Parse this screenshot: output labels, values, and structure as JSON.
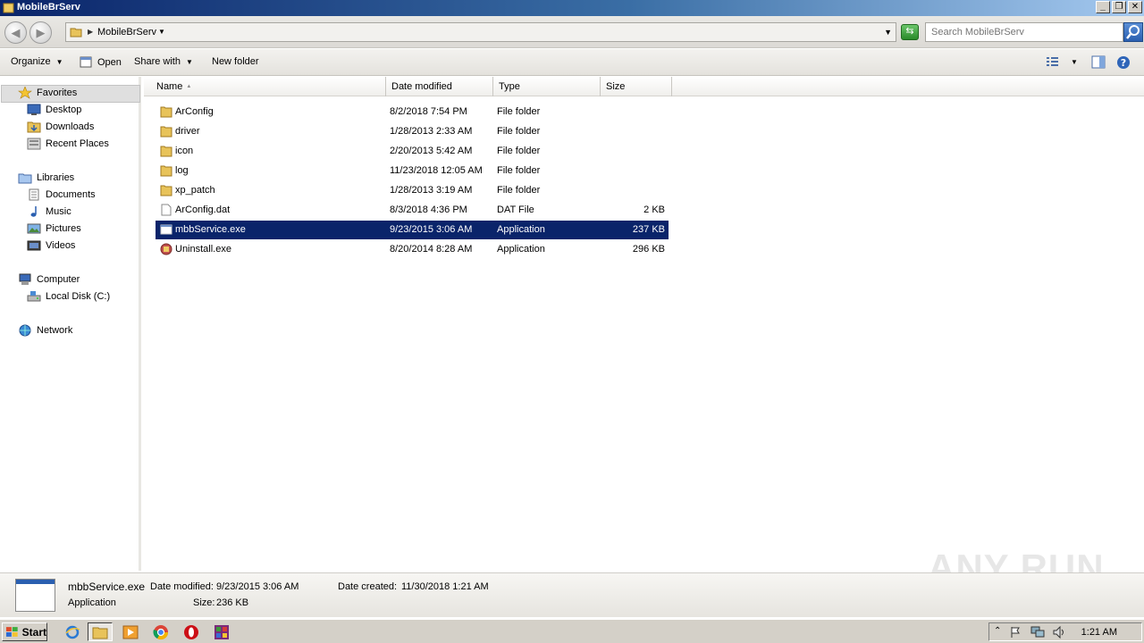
{
  "window": {
    "title": "MobileBrServ"
  },
  "address": {
    "crumb": "MobileBrServ"
  },
  "search": {
    "placeholder": "Search MobileBrServ"
  },
  "toolbar": {
    "organize": "Organize",
    "open": "Open",
    "share_with": "Share with",
    "new_folder": "New folder"
  },
  "nav": {
    "favorites": "Favorites",
    "desktop": "Desktop",
    "downloads": "Downloads",
    "recent_places": "Recent Places",
    "libraries": "Libraries",
    "documents": "Documents",
    "music": "Music",
    "pictures": "Pictures",
    "videos": "Videos",
    "computer": "Computer",
    "local_disk": "Local Disk (C:)",
    "network": "Network"
  },
  "columns": {
    "name": "Name",
    "date_modified": "Date modified",
    "type": "Type",
    "size": "Size"
  },
  "files": [
    {
      "name": "ArConfig",
      "date": "8/2/2018 7:54 PM",
      "type": "File folder",
      "size": "",
      "icon": "folder-icon"
    },
    {
      "name": "driver",
      "date": "1/28/2013 2:33 AM",
      "type": "File folder",
      "size": "",
      "icon": "folder-icon"
    },
    {
      "name": "icon",
      "date": "2/20/2013 5:42 AM",
      "type": "File folder",
      "size": "",
      "icon": "folder-icon"
    },
    {
      "name": "log",
      "date": "11/23/2018 12:05 AM",
      "type": "File folder",
      "size": "",
      "icon": "folder-icon"
    },
    {
      "name": "xp_patch",
      "date": "1/28/2013 3:19 AM",
      "type": "File folder",
      "size": "",
      "icon": "folder-icon"
    },
    {
      "name": "ArConfig.dat",
      "date": "8/3/2018 4:36 PM",
      "type": "DAT File",
      "size": "2 KB",
      "icon": "document-icon"
    },
    {
      "name": "mbbService.exe",
      "date": "9/23/2015 3:06 AM",
      "type": "Application",
      "size": "237 KB",
      "icon": "application-icon"
    },
    {
      "name": "Uninstall.exe",
      "date": "8/20/2014 8:28 AM",
      "type": "Application",
      "size": "296 KB",
      "icon": "uninstaller-icon"
    }
  ],
  "details": {
    "name": "mbbService.exe",
    "date_modified_label": "Date modified:",
    "date_modified": "9/23/2015 3:06 AM",
    "date_created_label": "Date created:",
    "date_created": "11/30/2018 1:21 AM",
    "type": "Application",
    "size_label": "Size:",
    "size": "236 KB"
  },
  "watermark": "ANY RUN",
  "taskbar": {
    "start": "Start",
    "clock": "1:21 AM"
  },
  "colors": {
    "selection": "#0a246a",
    "titlebar": "#0a246a",
    "folder": "#e8c35a"
  }
}
